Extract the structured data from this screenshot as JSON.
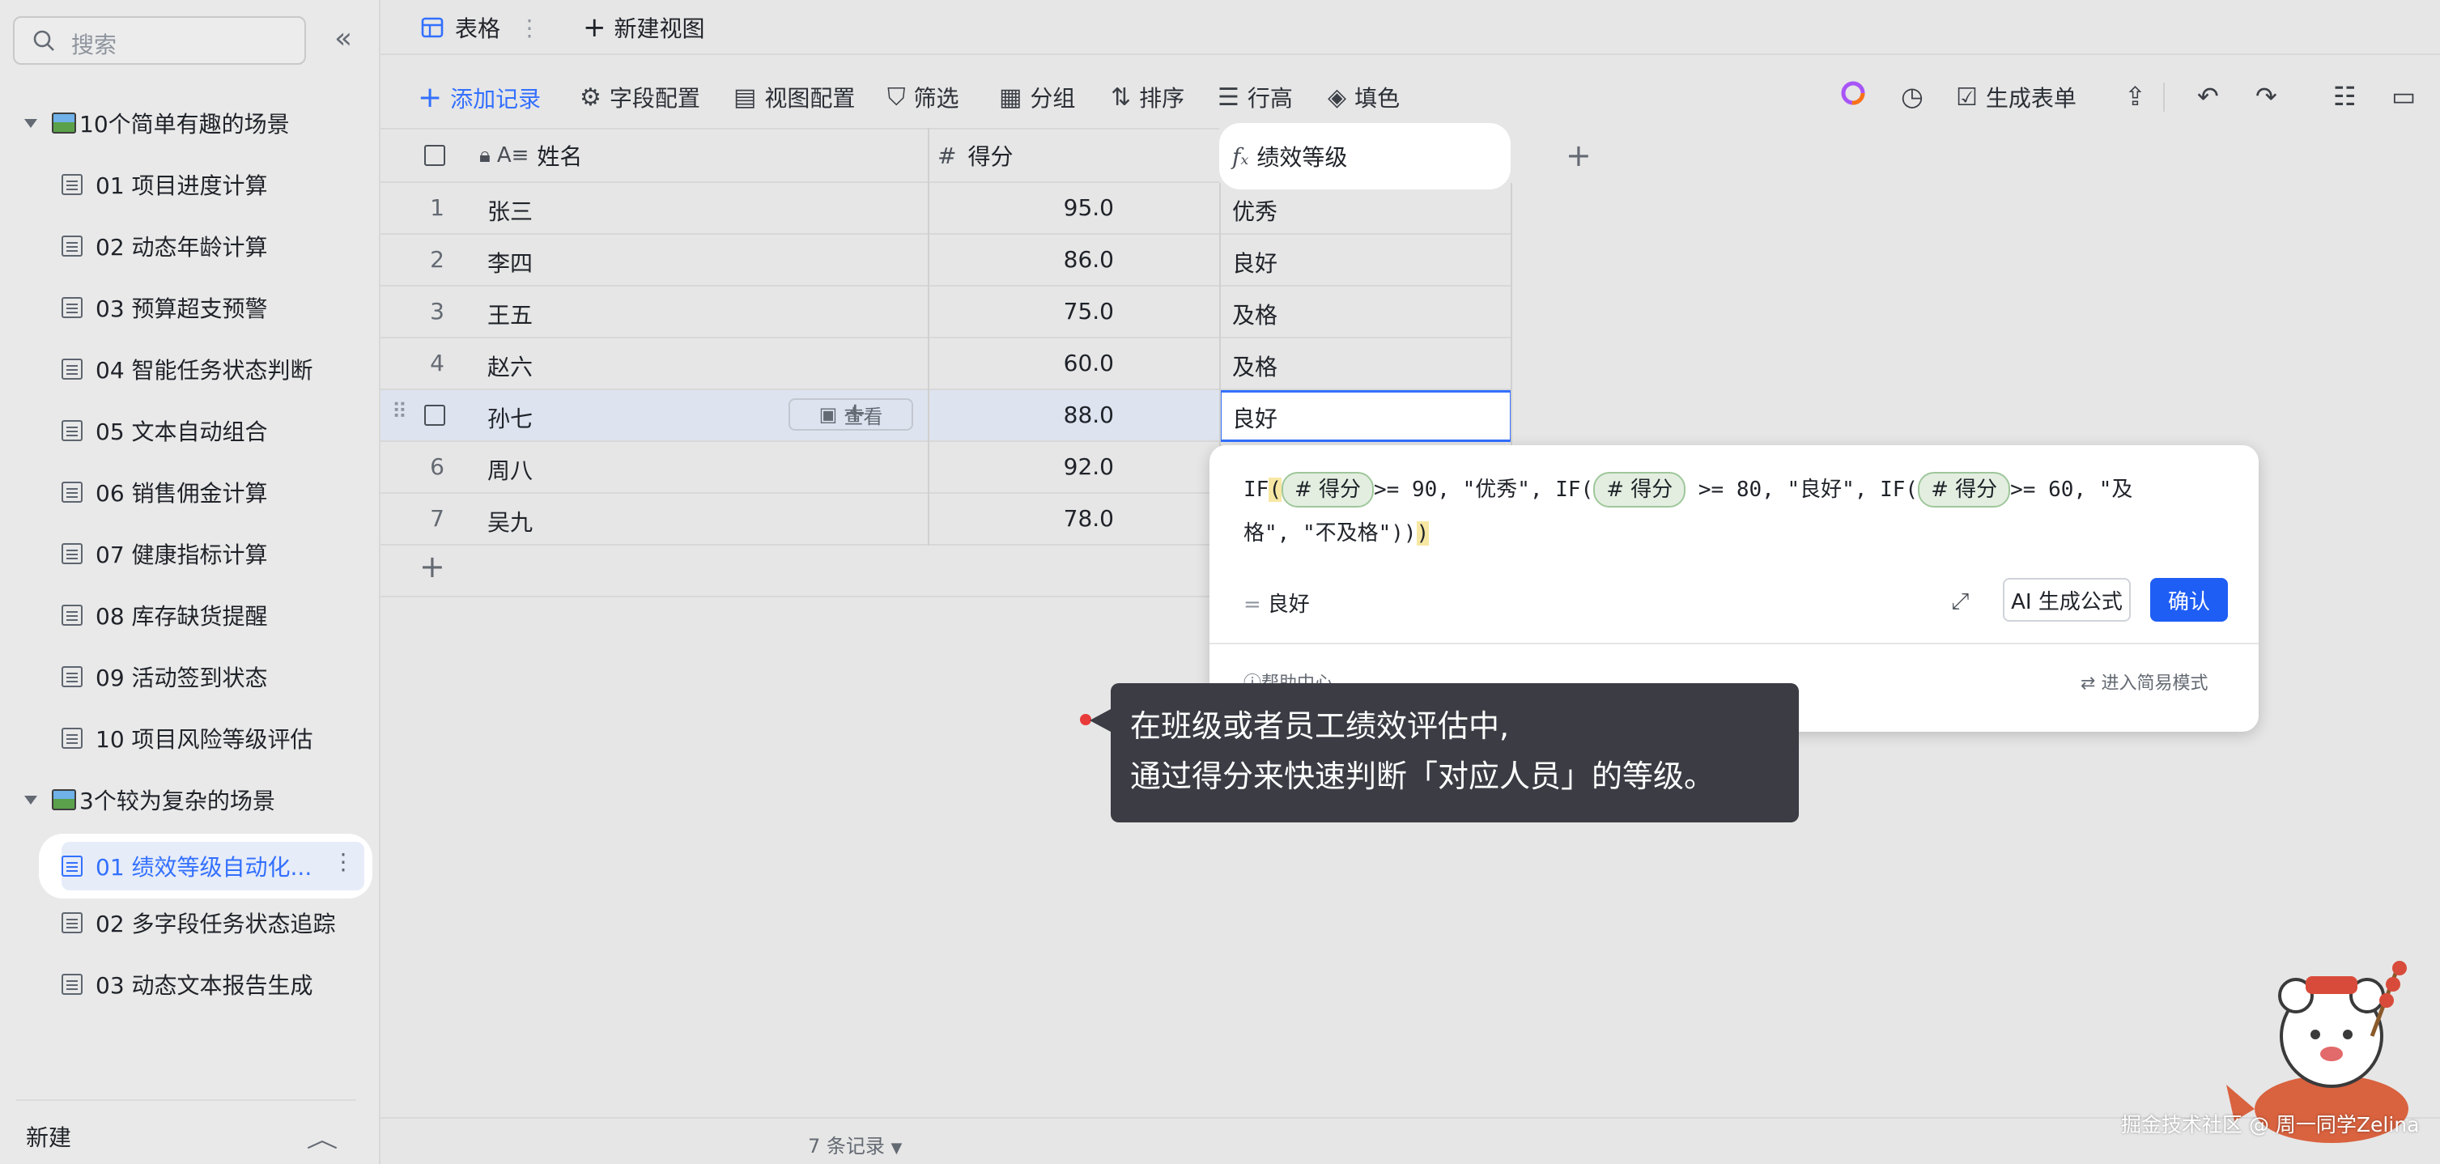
{
  "sidebar": {
    "search_placeholder": "搜索",
    "groups": [
      {
        "label": "10个简单有趣的场景",
        "items": [
          "01 项目进度计算",
          "02 动态年龄计算",
          "03 预算超支预警",
          "04 智能任务状态判断",
          "05 文本自动组合",
          "06 销售佣金计算",
          "07 健康指标计算",
          "08 库存缺货提醒",
          "09 活动签到状态",
          "10 项目风险等级评估"
        ]
      },
      {
        "label": "3个较为复杂的场景",
        "items": [
          "01 绩效等级自动化...",
          "02 多字段任务状态追踪",
          "03 动态文本报告生成"
        ]
      }
    ],
    "footer_label": "新建"
  },
  "tabs": {
    "table": "表格",
    "new_view": "新建视图"
  },
  "toolbar": {
    "add_record": "添加记录",
    "field_config": "字段配置",
    "view_config": "视图配置",
    "filter": "筛选",
    "group": "分组",
    "sort": "排序",
    "row_height": "行高",
    "fill_color": "填色",
    "generate_form": "生成表单"
  },
  "table": {
    "columns": {
      "name": "姓名",
      "score": "得分",
      "grade": "绩效等级"
    },
    "rows": [
      {
        "idx": "1",
        "name": "张三",
        "score": "95.0",
        "grade": "优秀"
      },
      {
        "idx": "2",
        "name": "李四",
        "score": "86.0",
        "grade": "良好"
      },
      {
        "idx": "3",
        "name": "王五",
        "score": "75.0",
        "grade": "及格"
      },
      {
        "idx": "4",
        "name": "赵六",
        "score": "60.0",
        "grade": "及格"
      },
      {
        "idx": "",
        "name": "孙七",
        "score": "88.0",
        "grade": "良好"
      },
      {
        "idx": "6",
        "name": "周八",
        "score": "92.0",
        "grade": ""
      },
      {
        "idx": "7",
        "name": "吴九",
        "score": "78.0",
        "grade": ""
      }
    ],
    "view_button": "查看",
    "record_count": "7 条记录"
  },
  "formula_editor": {
    "field_token": "# 得分",
    "seg1": ">= 90, \"优秀\", IF(",
    "seg2": " >= 80, \"良好\", IF(",
    "seg3": ">= 60, \"及",
    "seg4": "格\", \"不及格\"))",
    "result": "良好",
    "ai_button": "AI 生成公式",
    "confirm_button": "确认",
    "help": "帮助中心",
    "simple_mode": "进入简易模式"
  },
  "callout": {
    "line1": "在班级或者员工绩效评估中,",
    "line2": "通过得分来快速判断「对应人员」的等级。"
  },
  "watermark": "掘金技术社区 @ 周一同学Zelina",
  "colors": {
    "accent": "#3370ff",
    "selection": "#dde3ef",
    "callout_bg": "#3b3c44"
  }
}
